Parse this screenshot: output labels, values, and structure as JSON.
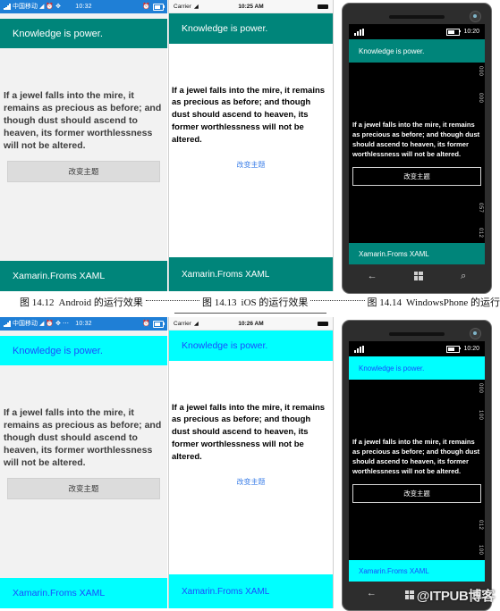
{
  "quote": "If a jewel falls into the mire, it remains as precious as before; and though dust should ascend to heaven, its former worthlessness will not be altered.",
  "header_text": "Knowledge is power.",
  "footer_text": "Xamarin.Froms XAML",
  "button_label": "改变主题",
  "colors": {
    "teal": "#00857a",
    "teal_text": "#ffffff",
    "cyan": "#00ffff",
    "cyan_text": "#1a4cff",
    "android_status": "#1f7fd6",
    "ios_link": "#3c7fe8"
  },
  "rows": [
    {
      "theme": "teal",
      "android": {
        "carrier": "中国移动",
        "time": "10:32",
        "icons": [
          "signal-icon",
          "wifi-icon",
          "alarm-icon",
          "bluetooth-icon"
        ],
        "right_icons": [
          "alarm-icon",
          "battery-icon"
        ]
      },
      "ios": {
        "carrier": "Carrier",
        "time": "10:25 AM",
        "wifi": "wifi-icon"
      },
      "wp": {
        "time": "10:20",
        "marks": [
          "000",
          "000",
          "057",
          "012"
        ],
        "nav": [
          "back-arrow-icon",
          "windows-logo-icon",
          "search-icon"
        ]
      }
    },
    {
      "theme": "cyan",
      "android": {
        "carrier": "中国移动",
        "time": "10:32",
        "icons": [
          "signal-icon",
          "wifi-icon",
          "alarm-icon",
          "bluetooth-icon",
          "more-icon"
        ],
        "right_icons": [
          "alarm-icon",
          "battery-icon"
        ]
      },
      "ios": {
        "carrier": "Carrier",
        "time": "10:26 AM",
        "wifi": "wifi-icon"
      },
      "wp": {
        "time": "10:20",
        "marks": [
          "000",
          "100",
          "012",
          "100"
        ],
        "nav": [
          "back-arrow-icon"
        ]
      }
    }
  ],
  "captions": [
    {
      "figure": "图 14.12",
      "text": "Android 的运行效果"
    },
    {
      "figure": "图 14.13",
      "text": "iOS 的运行效果"
    },
    {
      "figure": "图 14.14",
      "text": "WindowsPhone 的运行效果"
    }
  ],
  "watermark": "@ITPUB博客"
}
